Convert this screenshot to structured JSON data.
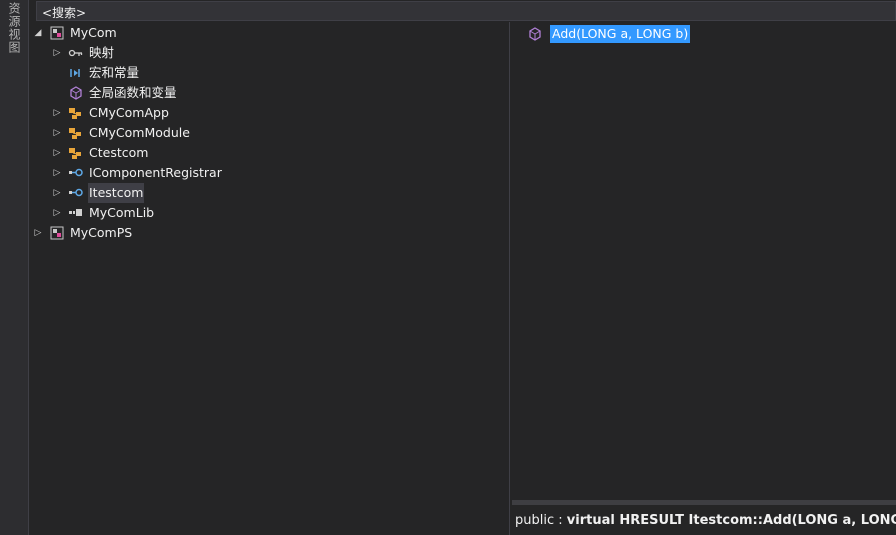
{
  "side_tab": {
    "label": "资源视图"
  },
  "search": {
    "placeholder": "<搜索>"
  },
  "tree": [
    {
      "label": "MyCom",
      "icon": "project-icon",
      "state": "expanded",
      "level": 0
    },
    {
      "label": "映射",
      "icon": "map-key-icon",
      "state": "collapsed",
      "level": 1
    },
    {
      "label": "宏和常量",
      "icon": "macro-icon",
      "state": "none",
      "level": 1
    },
    {
      "label": "全局函数和变量",
      "icon": "global-function-icon",
      "state": "none",
      "level": 1
    },
    {
      "label": "CMyComApp",
      "icon": "class-icon",
      "state": "collapsed",
      "level": 1
    },
    {
      "label": "CMyComModule",
      "icon": "class-icon",
      "state": "collapsed",
      "level": 1
    },
    {
      "label": "Ctestcom",
      "icon": "class-icon",
      "state": "collapsed",
      "level": 1
    },
    {
      "label": "IComponentRegistrar",
      "icon": "interface-icon",
      "state": "collapsed",
      "level": 1
    },
    {
      "label": "Itestcom",
      "icon": "interface-icon",
      "state": "collapsed",
      "level": 1,
      "selected": true
    },
    {
      "label": "MyComLib",
      "icon": "library-icon",
      "state": "collapsed",
      "level": 1
    },
    {
      "label": "MyComPS",
      "icon": "project-icon",
      "state": "collapsed",
      "level": 0
    }
  ],
  "members": [
    {
      "label": "Add(LONG a, LONG b)",
      "icon": "method-icon",
      "selected": true
    }
  ],
  "description": {
    "prefix": "public : ",
    "signature": "virtual HRESULT Itestcom::Add(LONG a, LONG b)"
  },
  "colors": {
    "background": "#252526",
    "selection": "#3399ff",
    "class_icon": "#e8a53a",
    "interface_icon": "#5ea8e6",
    "method_icon": "#b180d7"
  }
}
